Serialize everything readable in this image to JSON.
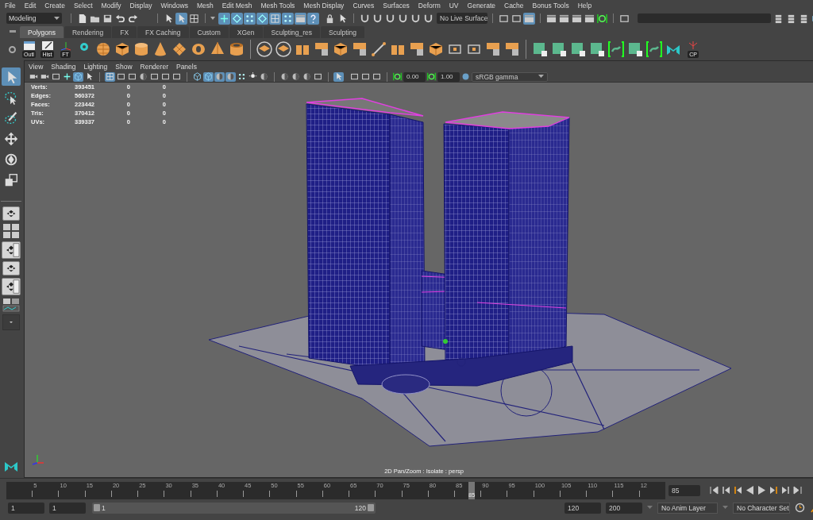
{
  "menu_bar": [
    "File",
    "Edit",
    "Create",
    "Select",
    "Modify",
    "Display",
    "Windows",
    "Mesh",
    "Edit Mesh",
    "Mesh Tools",
    "Mesh Display",
    "Curves",
    "Surfaces",
    "Deform",
    "UV",
    "Generate",
    "Cache",
    "Bonus Tools",
    "Help"
  ],
  "status_line": {
    "mode": "Modeling",
    "select_tools": [
      {
        "on": false
      },
      {
        "on": true
      },
      {
        "on": false
      }
    ],
    "selection_masks": [
      {
        "on": true
      },
      {
        "on": true
      },
      {
        "on": true
      },
      {
        "on": true
      },
      {
        "on": true
      },
      {
        "on": true
      },
      {
        "on": true
      },
      {
        "on": true
      }
    ],
    "history_tools": [
      {
        "on": false
      },
      {
        "on": false
      },
      {
        "on": true
      }
    ],
    "live_surface": "No Live Surface"
  },
  "shelf": {
    "tabs": [
      {
        "label": "Polygons",
        "selected": true
      },
      {
        "label": "Rendering",
        "selected": false
      },
      {
        "label": "FX",
        "selected": false
      },
      {
        "label": "FX Caching",
        "selected": false
      },
      {
        "label": "Custom",
        "selected": false
      },
      {
        "label": "XGen",
        "selected": false
      },
      {
        "label": "Sculpting_res",
        "selected": false
      },
      {
        "label": "Sculpting",
        "selected": false
      }
    ],
    "labeled_buttons": [
      "Outl",
      "Hist",
      "FT"
    ],
    "plugin_button": "CP"
  },
  "panel": {
    "menus": [
      "View",
      "Shading",
      "Lighting",
      "Show",
      "Renderer",
      "Panels"
    ],
    "camera_tools": [
      {
        "on": false
      },
      {
        "on": false
      },
      {
        "on": false
      },
      {
        "on": false
      },
      {
        "on": true
      },
      {
        "on": false
      }
    ],
    "grid_tools": [
      {
        "on": true
      },
      {
        "on": false
      },
      {
        "on": false
      },
      {
        "on": false
      },
      {
        "on": false
      },
      {
        "on": false
      },
      {
        "on": false
      }
    ],
    "shading_tools": [
      {
        "on": false
      },
      {
        "on": true
      },
      {
        "on": true
      },
      {
        "on": true
      },
      {
        "on": false
      },
      {
        "on": false
      },
      {
        "on": false
      }
    ],
    "isolate_on": true,
    "exposure": "0.00",
    "gamma": "1.00",
    "color_space": "sRGB gamma"
  },
  "heads_up_display": [
    {
      "label": "Verts:",
      "values": [
        "393451",
        "0",
        "0"
      ]
    },
    {
      "label": "Edges:",
      "values": [
        "560372",
        "0",
        "0"
      ]
    },
    {
      "label": "Faces:",
      "values": [
        "223442",
        "0",
        "0"
      ]
    },
    {
      "label": "Tris:",
      "values": [
        "370412",
        "0",
        "0"
      ]
    },
    {
      "label": "UVs:",
      "values": [
        "339337",
        "0",
        "0"
      ]
    }
  ],
  "viewport_caption": "2D Pan/Zoom : Isolate : persp",
  "time_slider": {
    "ticks": [
      "5",
      "10",
      "15",
      "20",
      "25",
      "30",
      "35",
      "40",
      "45",
      "50",
      "55",
      "60",
      "65",
      "70",
      "75",
      "80",
      "85",
      "90",
      "95",
      "100",
      "105",
      "110",
      "115",
      "12"
    ],
    "playhead": {
      "label": "85",
      "level": 0.7025
    },
    "current_frame": "85"
  },
  "range_slider": {
    "handles": [
      {
        "level": 0
      },
      {
        "level": 1
      }
    ],
    "start": "1",
    "playback_start": "1",
    "range_start": "1",
    "range_end": "120",
    "playback_end": "120",
    "end": "200",
    "anim_layer": "No Anim Layer",
    "character_set": "No Character Set"
  }
}
